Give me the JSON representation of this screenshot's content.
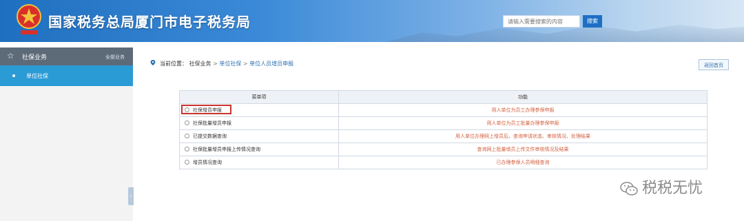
{
  "header": {
    "title": "国家税务总局厦门市电子税务局",
    "search_placeholder": "请输入需要搜索的内容",
    "search_button": "搜索",
    "colors": {
      "banner_left": "#1f6fc0",
      "banner_right": "#d8e7f5"
    }
  },
  "sidebar": {
    "head_label": "社保业务",
    "all_services": "全部业务",
    "active_item": "单位社保",
    "active_color": "#2b9bd6"
  },
  "breadcrumb": {
    "prefix": "当前位置：",
    "item1": "社保业务",
    "item2": "单位社保",
    "item3": "单位人员增员申报",
    "sep": ">"
  },
  "back_button": "返回首页",
  "table": {
    "headers": [
      "菜单项",
      "功能"
    ],
    "rows": [
      {
        "menu": "社保增员申报",
        "func": "用人单位为员工办理参保申报"
      },
      {
        "menu": "社保批量增员申报",
        "func": "用人单位为员工批量办理参保申报"
      },
      {
        "menu": "已提交数据查询",
        "func": "用人单位办理网上增员后，查询申请状态、审核情况、处理结果"
      },
      {
        "menu": "社保批量增员申报上传情况查询",
        "func": "查询网上批量增员上传文件审核情况及结果"
      },
      {
        "menu": "增员情况查询",
        "func": "已办理参保人员明细查询"
      }
    ],
    "highlight_color": "#c9322f"
  },
  "watermark": "税税无忧"
}
